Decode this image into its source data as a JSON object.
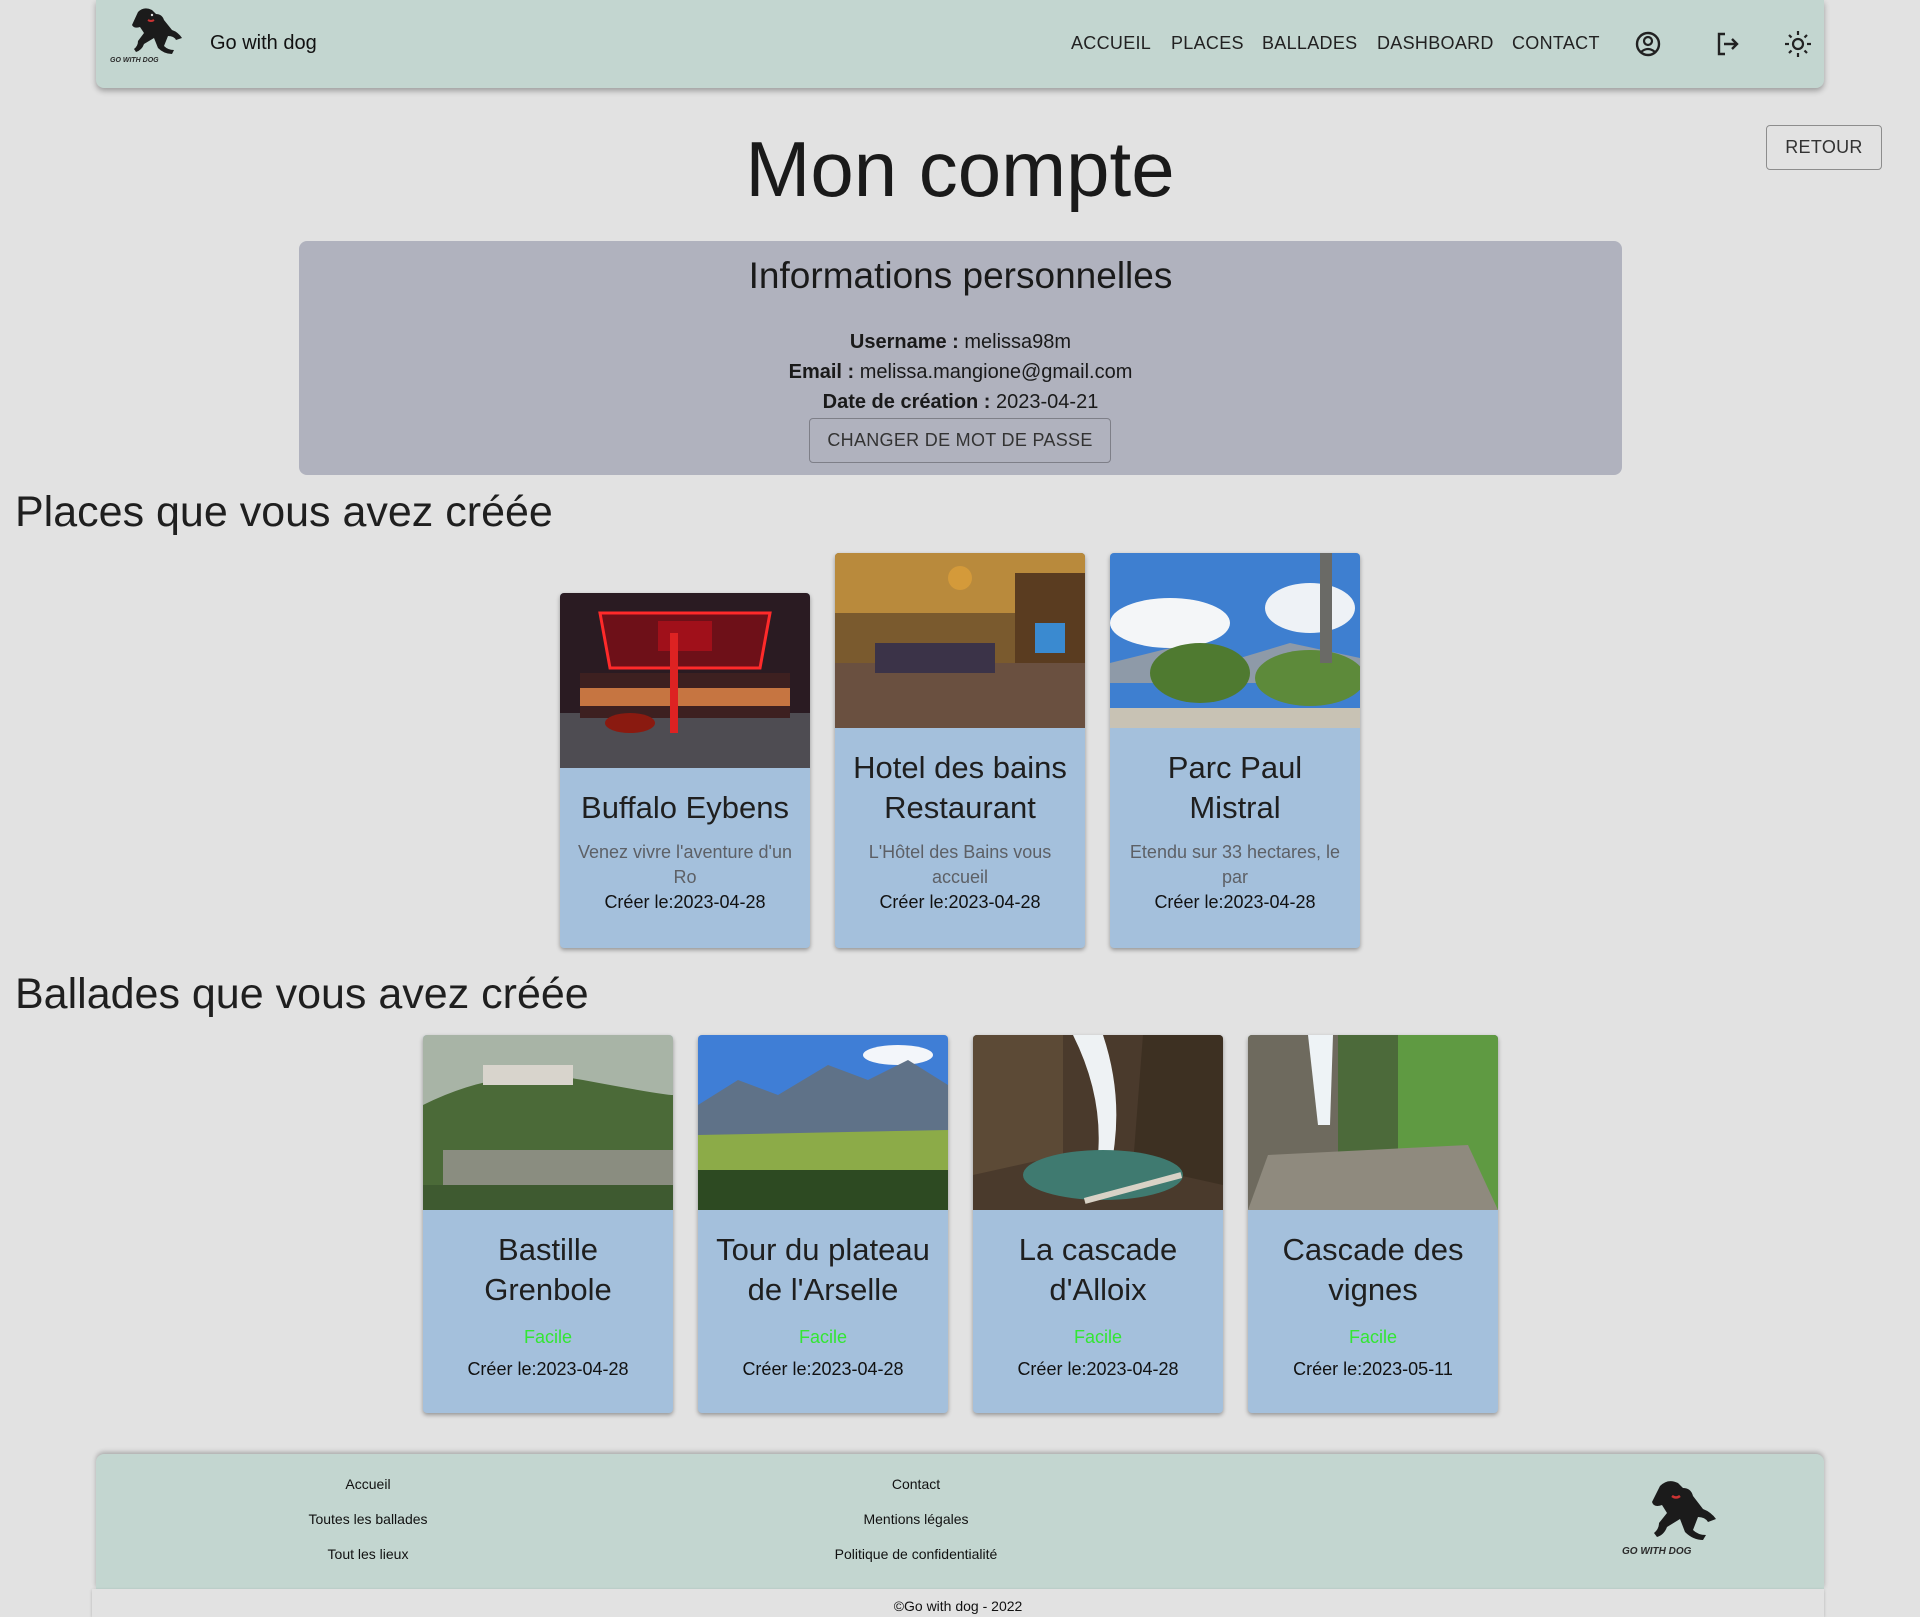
{
  "header": {
    "brand": "Go with dog",
    "nav": [
      "ACCUEIL",
      "PLACES",
      "BALLADES",
      "DASHBOARD",
      "CONTACT"
    ],
    "logo_text": "GO WITH DOG"
  },
  "page": {
    "title": "Mon compte",
    "return_label": "RETOUR"
  },
  "info": {
    "title": "Informations personnelles",
    "username_label": "Username :",
    "username": "melissa98m",
    "email_label": "Email :",
    "email": "melissa.mangione@gmail.com",
    "date_label": "Date de création :",
    "date": "2023-04-21",
    "change_pwd_label": "CHANGER DE MOT DE PASSE"
  },
  "places": {
    "title": "Places que vous avez créée",
    "items": [
      {
        "name": "Buffalo Eybens",
        "desc": "Venez vivre l'aventure d'un Ro",
        "date": "Créer le:2023-04-28"
      },
      {
        "name": "Hotel des bains Restaurant",
        "desc": "L'Hôtel des Bains vous accueil",
        "date": "Créer le:2023-04-28"
      },
      {
        "name": "Parc Paul Mistral",
        "desc": "Etendu sur 33 hectares, le par",
        "date": "Créer le:2023-04-28"
      }
    ]
  },
  "ballades": {
    "title": "Ballades que vous avez créée",
    "items": [
      {
        "name": "Bastille Grenbole",
        "level": "Facile",
        "date": "Créer le:2023-04-28"
      },
      {
        "name": "Tour du plateau de l'Arselle",
        "level": "Facile",
        "date": "Créer le:2023-04-28"
      },
      {
        "name": "La cascade d'Alloix",
        "level": "Facile",
        "date": "Créer le:2023-04-28"
      },
      {
        "name": "Cascade des vignes",
        "level": "Facile",
        "date": "Créer le:2023-05-11"
      }
    ]
  },
  "footer": {
    "col1": [
      "Accueil",
      "Toutes les ballades",
      "Tout les lieux"
    ],
    "col2": [
      "Contact",
      "Mentions légales",
      "Politique de confidentialité"
    ],
    "copyright": "©Go with dog - 2022"
  },
  "colors": {
    "navbar": "#c3d6d0",
    "panel": "#b0b2be",
    "card": "#a4c0dc",
    "level_easy": "#33e633"
  }
}
